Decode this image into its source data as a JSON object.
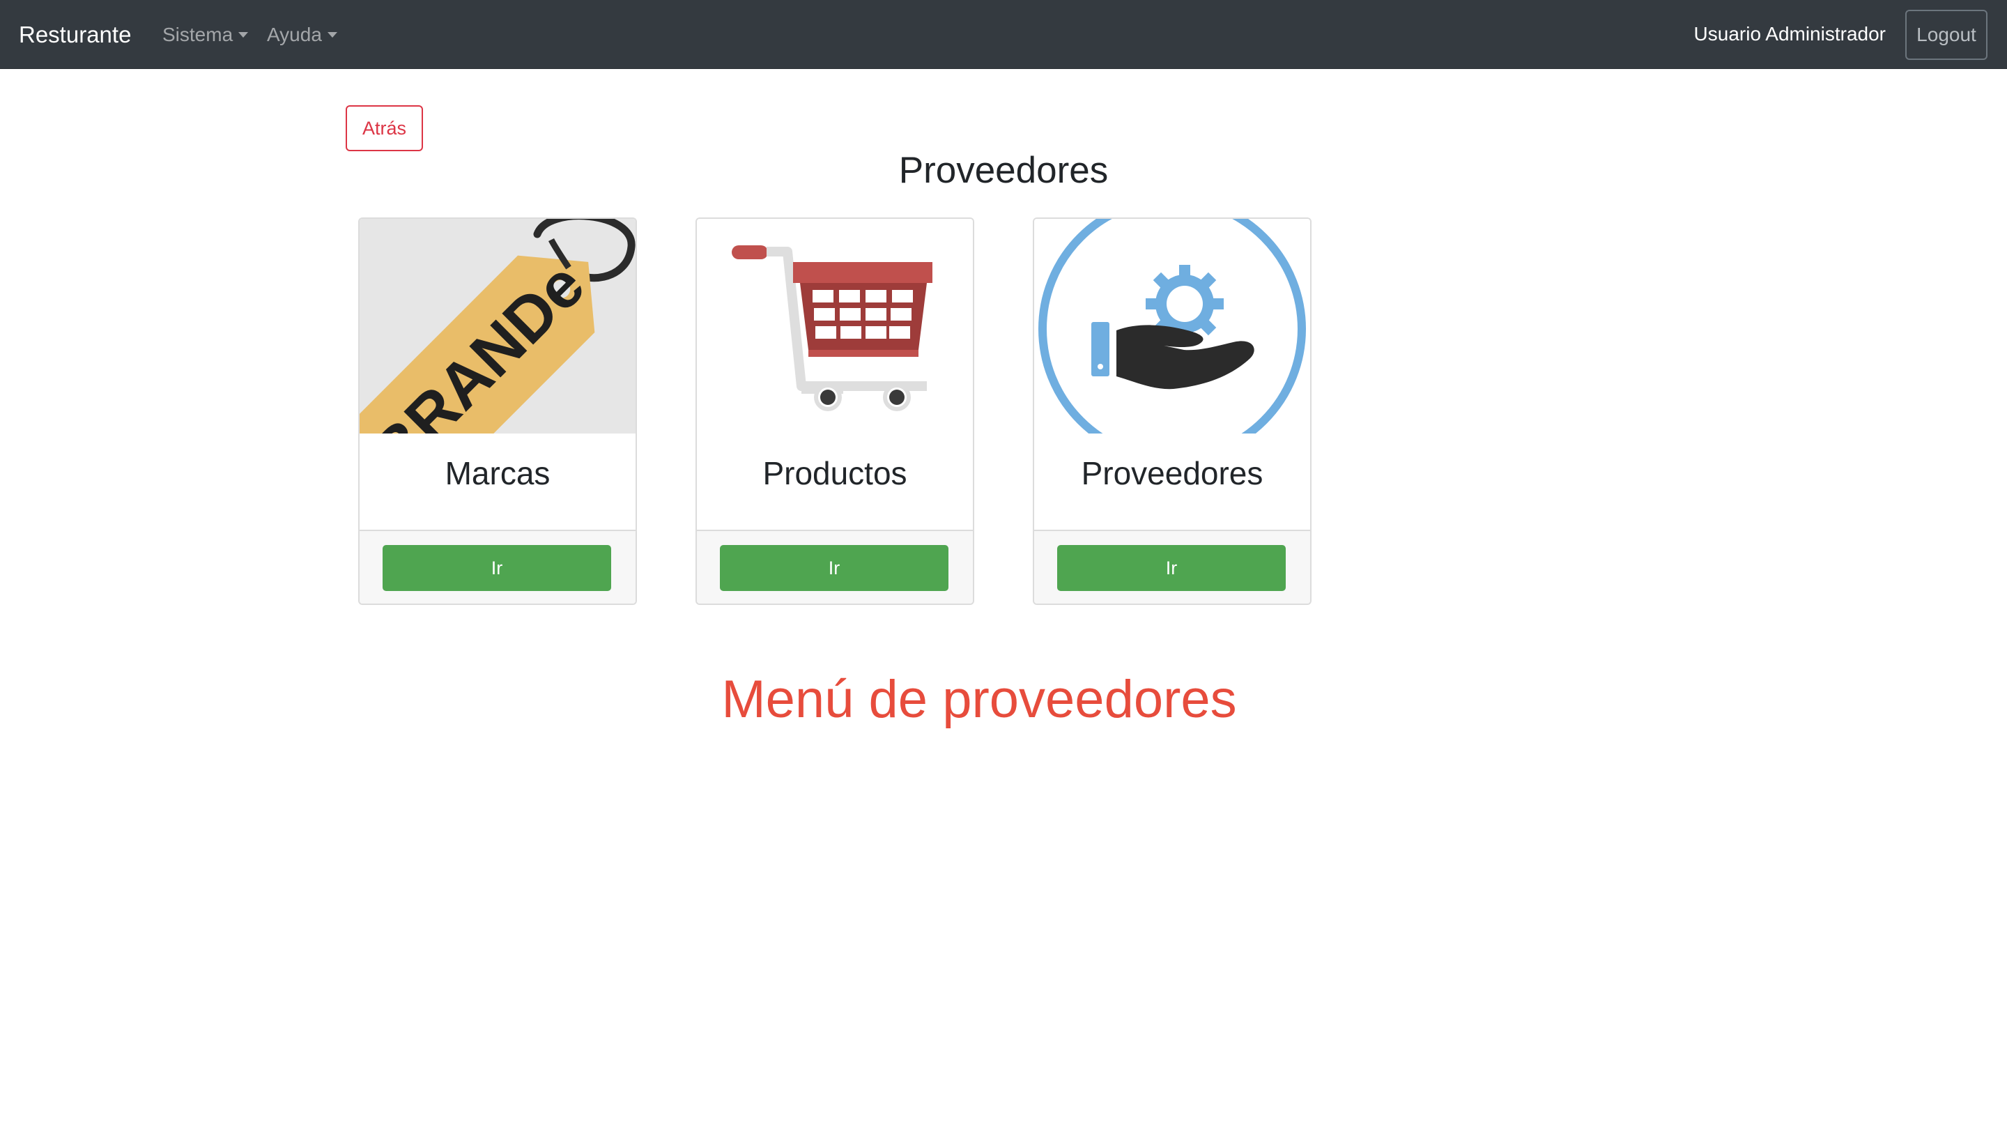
{
  "navbar": {
    "brand": "Resturante",
    "menus": [
      {
        "label": "Sistema"
      },
      {
        "label": "Ayuda"
      }
    ],
    "user": "Usuario Administrador",
    "logout_label": "Logout"
  },
  "back_label": "Atrás",
  "page_title": "Proveedores",
  "cards": [
    {
      "title": "Marcas",
      "button": "Ir",
      "image_icon": "brand-tag-icon",
      "image_text": "BRANDe"
    },
    {
      "title": "Productos",
      "button": "Ir",
      "image_icon": "shopping-cart-icon"
    },
    {
      "title": "Proveedores",
      "button": "Ir",
      "image_icon": "hand-gear-icon"
    }
  ],
  "footer_heading": "Menú de proveedores",
  "colors": {
    "navbar_bg": "#343a40",
    "success": "#4fa550",
    "danger": "#dc3545",
    "heading_red": "#e74c3c"
  }
}
